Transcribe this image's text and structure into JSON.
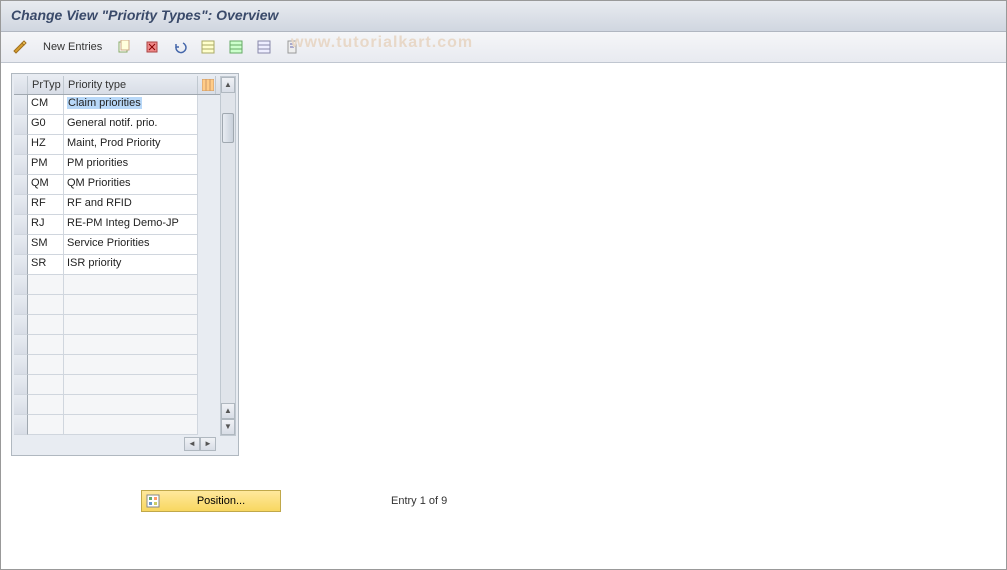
{
  "titleBar": {
    "text": "Change View \"Priority Types\": Overview"
  },
  "toolbar": {
    "newEntries": "New Entries",
    "watermark": "www.tutorialkart.com"
  },
  "grid": {
    "headers": {
      "prtyp": "PrTyp",
      "desc": "Priority type"
    },
    "rows": [
      {
        "prtyp": "CM",
        "desc": "Claim priorities",
        "selected": true
      },
      {
        "prtyp": "G0",
        "desc": "General notif. prio."
      },
      {
        "prtyp": "HZ",
        "desc": "Maint, Prod Priority"
      },
      {
        "prtyp": "PM",
        "desc": "PM priorities"
      },
      {
        "prtyp": "QM",
        "desc": "QM Priorities"
      },
      {
        "prtyp": "RF",
        "desc": "RF and RFID"
      },
      {
        "prtyp": "RJ",
        "desc": "RE-PM Integ Demo-JP"
      },
      {
        "prtyp": "SM",
        "desc": "Service Priorities"
      },
      {
        "prtyp": "SR",
        "desc": "ISR priority"
      }
    ],
    "emptyRows": 8
  },
  "footer": {
    "positionLabel": "Position...",
    "entryText": "Entry 1 of 9"
  }
}
